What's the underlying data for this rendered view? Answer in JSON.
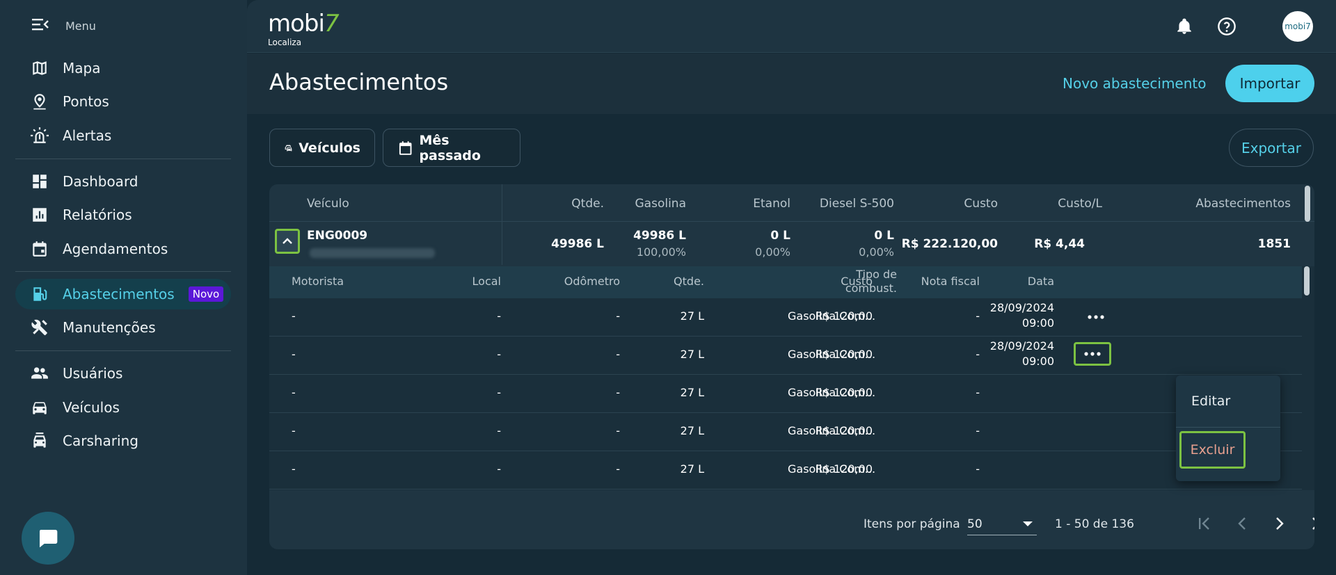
{
  "sidebar": {
    "menu_label": "Menu",
    "items": [
      {
        "label": "Mapa",
        "icon": "map-icon"
      },
      {
        "label": "Pontos",
        "icon": "location-pin-icon"
      },
      {
        "label": "Alertas",
        "icon": "siren-icon"
      },
      {
        "label": "Dashboard",
        "icon": "dashboard-icon"
      },
      {
        "label": "Relatórios",
        "icon": "chart-icon"
      },
      {
        "label": "Agendamentos",
        "icon": "calendar-icon"
      },
      {
        "label": "Abastecimentos",
        "icon": "fuel-icon",
        "badge": "Novo",
        "active": true
      },
      {
        "label": "Manutenções",
        "icon": "tools-icon"
      },
      {
        "label": "Usuários",
        "icon": "users-icon"
      },
      {
        "label": "Veículos",
        "icon": "car-icon"
      },
      {
        "label": "Carsharing",
        "icon": "carsharing-icon"
      }
    ]
  },
  "topbar": {
    "logo_main": "mobi",
    "logo_seven": "7",
    "logo_sub": "Localiza",
    "avatar_text": "mobi7"
  },
  "header": {
    "title": "Abastecimentos",
    "new_label": "Novo abastecimento",
    "import_label": "Importar"
  },
  "filters": {
    "vehicles_label": "Veículos",
    "period_label": "Mês passado",
    "export_label": "Exportar"
  },
  "table": {
    "columns": [
      "Veículo",
      "Qtde.",
      "Gasolina",
      "Etanol",
      "Diesel S-500",
      "Custo",
      "Custo/L",
      "Abastecimentos"
    ],
    "row": {
      "plate": "ENG0009",
      "qty": "49986 L",
      "gasolina": "49986 L",
      "gasolina_pct": "100,00%",
      "etanol": "0 L",
      "etanol_pct": "0,00%",
      "diesel": "0 L",
      "diesel_pct": "0,00%",
      "custo": "R$ 222.120,00",
      "custo_l": "R$ 4,44",
      "abastecimentos": "1851"
    }
  },
  "inner_table": {
    "columns": [
      "Motorista",
      "Local",
      "Odômetro",
      "Qtde.",
      "Tipo de combust.",
      "Custo",
      "Nota fiscal",
      "Data"
    ],
    "rows": [
      {
        "motorista": "-",
        "local": "-",
        "odometro": "-",
        "qtde": "27 L",
        "tipo": "Gasolina Com...",
        "custo": "R$ 120,00",
        "nota": "-",
        "data": "28/09/2024",
        "hora": "09:00"
      },
      {
        "motorista": "-",
        "local": "-",
        "odometro": "-",
        "qtde": "27 L",
        "tipo": "Gasolina Com...",
        "custo": "R$ 120,00",
        "nota": "-",
        "data": "28/09/2024",
        "hora": "09:00"
      },
      {
        "motorista": "-",
        "local": "-",
        "odometro": "-",
        "qtde": "27 L",
        "tipo": "Gasolina Com...",
        "custo": "R$ 120,00",
        "nota": "-",
        "data": "",
        "hora": ""
      },
      {
        "motorista": "-",
        "local": "-",
        "odometro": "-",
        "qtde": "27 L",
        "tipo": "Gasolina Com...",
        "custo": "R$ 120,00",
        "nota": "-",
        "data": "",
        "hora": ""
      },
      {
        "motorista": "-",
        "local": "-",
        "odometro": "-",
        "qtde": "27 L",
        "tipo": "Gasolina Com...",
        "custo": "R$ 120,00",
        "nota": "-",
        "data": "",
        "hora": ""
      }
    ]
  },
  "context_menu": {
    "edit_label": "Editar",
    "delete_label": "Excluir"
  },
  "pagination": {
    "items_per_page_label": "Itens por página",
    "page_size": "50",
    "range": "1 - 50 de 136"
  },
  "colors": {
    "accent": "#55d0e8",
    "highlight": "#7cc242",
    "badge": "#5b18d8",
    "danger_text": "#e8a08f"
  }
}
